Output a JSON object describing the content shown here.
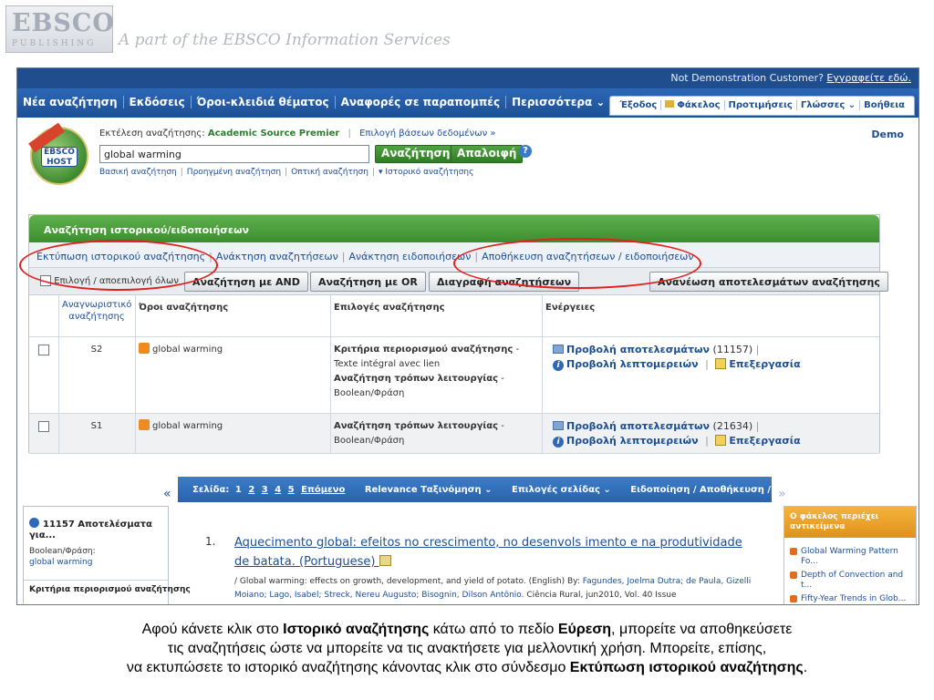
{
  "brand": {
    "logo_text": "EBSCO",
    "logo_sub": "PUBLISHING",
    "tagline": "A part of the EBSCO Information Services"
  },
  "topbar": {
    "customer": "Not Demonstration Customer?",
    "signin": "Εγγραφείτε εδώ."
  },
  "nav": {
    "left": [
      "Νέα αναζήτηση",
      "Εκδόσεις",
      "Όροι-κλειδιά θέματος",
      "Αναφορές σε παραπομπές",
      "Περισσότερα ⌄"
    ],
    "right": [
      "Έξοδος",
      "Φάκελος",
      "Προτιμήσεις",
      "Γλώσσες ⌄",
      "Βοήθεια"
    ]
  },
  "search": {
    "badge_text": "EBSCO HOST",
    "searching_label": "Εκτέλεση αναζήτησης:",
    "database": "Academic Source Premier",
    "choose_db": "Επιλογή βάσεων δεδομένων »",
    "query": "global warming",
    "search_button": "Αναζήτηση",
    "clear_button": "Απαλοιφή",
    "help_icon": "?",
    "links": [
      "Βασική αναζήτηση",
      "Προηγμένη αναζήτηση",
      "Οπτική αναζήτηση",
      "▾ Ιστορικό αναζήτησης"
    ],
    "demo": "Demo"
  },
  "history": {
    "header": "Αναζήτηση ιστορικού/ειδοποιήσεων",
    "links": [
      "Εκτύπωση ιστορικού αναζήτησης",
      "Ανάκτηση αναζητήσεων",
      "Ανάκτηση ειδοποιήσεων",
      "Αποθήκευση αναζητήσεων / ειδοποιήσεων"
    ],
    "select_all": "Επιλογή / αποεπιλογή όλων",
    "buttons": [
      "Αναζήτηση με AND",
      "Αναζήτηση με OR",
      "Διαγραφή αναζητήσεων",
      "Ανανέωση αποτελεσμάτων αναζήτησης"
    ],
    "columns": [
      "Αναγνωριστικό αναζήτησης",
      "Όροι αναζήτησης",
      "Επιλογές αναζήτησης",
      "Ενέργειες"
    ],
    "rows": [
      {
        "id": "S2",
        "term": "global warming",
        "limiter_label": "Κριτήρια περιορισμού αναζήτησης",
        "limiter_value": " - Texte intégral avec lien",
        "mode_label": "Αναζήτηση τρόπων λειτουργίας",
        "mode_value": " - Boolean/Φράση",
        "view_results": "Προβολή αποτελεσμάτων",
        "count": "(11157)",
        "view_details": "Προβολή λεπτομερειών",
        "edit": "Επεξεργασία"
      },
      {
        "id": "S1",
        "term": "global warming",
        "mode_label": "Αναζήτηση τρόπων λειτουργίας",
        "mode_value": " - Boolean/Φράση",
        "view_results": "Προβολή αποτελεσμάτων",
        "count": "(21634)",
        "view_details": "Προβολή λεπτομερειών",
        "edit": "Επεξεργασία"
      }
    ]
  },
  "results_bar": {
    "collapse": "«",
    "pages_label": "Σελίδα:",
    "pages": [
      "1",
      "2",
      "3",
      "4",
      "5"
    ],
    "next": "Επόμενο",
    "sort": "Relevance Ταξινόμηση ⌄",
    "page_options": "Επιλογές σελίδας ⌄",
    "share": "Ειδοποίηση / Αποθήκευση / Κοινοποίηση ⌄",
    "expand": "»"
  },
  "left_panel": {
    "count_title": "11157 Αποτελέσματα για...",
    "mode": "Boolean/Φράση:",
    "query": "global warming",
    "limiters": "Κριτήρια περιορισμού αναζήτησης"
  },
  "result": {
    "number": "1.",
    "title": "Aquecimento global: efeitos no crescimento, no desenvols imento e na produtividade de batata. (Portuguese)",
    "cite_en": "/ Global warming: effects on growth, development, and yield of potato. (English)",
    "by": " By: ",
    "authors": "Fagundes, Joelma Dutra; de Paula, Gizelli Moiano; Lago, Isabel; Streck, Nereu Augusto; Bisognin, Dilson Antônio.",
    "journal": " Ciência Rural, jun2010, Vol. 40 Issue"
  },
  "right_panel": {
    "header": "Ο φάκελος περιέχει αντικείμενα",
    "items": [
      "Global Warming Pattern Fo...",
      "Depth of Convection and t...",
      "Fifty-Year Trends in Glob..."
    ]
  },
  "caption": {
    "line1_a": "Αφού κάνετε κλικ στο ",
    "line1_b": "Ιστορικό αναζήτησης",
    "line1_c": " κάτω από το πεδίο ",
    "line1_d": "Εύρεση",
    "line1_e": ", μπορείτε να αποθηκεύσετε",
    "line2": "τις αναζητήσεις ώστε να μπορείτε να τις ανακτήσετε για μελλοντική χρήση. Μπορείτε, επίσης,",
    "line3_a": "να εκτυπώσετε το ιστορικό αναζήτησης κάνοντας κλικ στο σύνδεσμο ",
    "line3_b": "Εκτύπωση ιστορικού αναζήτησης",
    "line3_c": "."
  }
}
